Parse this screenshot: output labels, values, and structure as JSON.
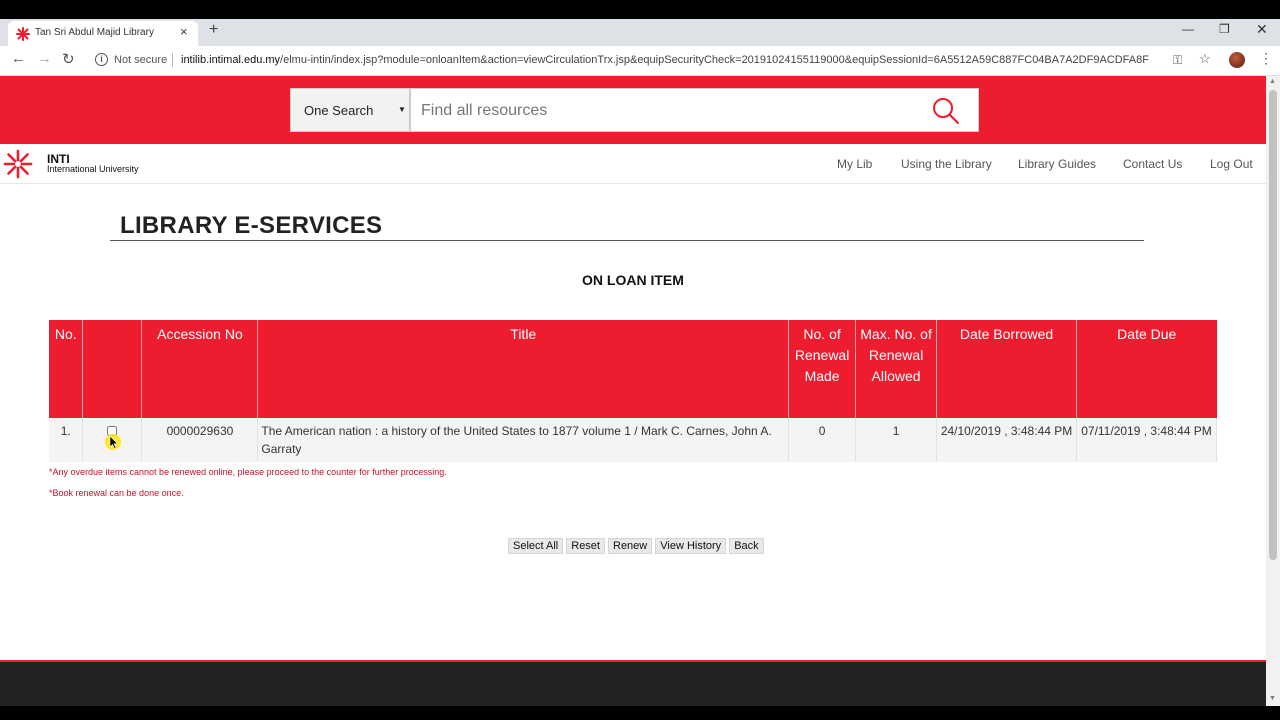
{
  "browser": {
    "tab_title": "Tan Sri Abdul Majid Library",
    "tab_close": "×",
    "new_tab": "+",
    "security_label": "Not secure",
    "url_host": "intilib.intimal.edu.my",
    "url_path": "/elmu-intin/index.jsp?module=onloanItem&action=viewCirculationTrx.jsp&equipSecurityCheck=20191024155119000&equipSessionId=6A5512A59C887FC04BA7A2DF9ACDFA8F"
  },
  "search": {
    "scope_label": "One Search",
    "placeholder": "Find all resources",
    "value": ""
  },
  "header": {
    "logo_name": "INTI",
    "logo_sub": "International University",
    "nav": [
      "My Lib",
      "Using the Library",
      "Library Guides",
      "Contact Us",
      "Log Out"
    ]
  },
  "page": {
    "title": "LIBRARY E-SERVICES",
    "section_title": "ON LOAN ITEM"
  },
  "table": {
    "headers": {
      "no": "No.",
      "select": "",
      "accession": "Accession No",
      "title": "Title",
      "renewal_made": "No. of Renewal Made",
      "renewal_allowed": "Max. No. of Renewal Allowed",
      "borrowed": "Date Borrowed",
      "due": "Date Due"
    },
    "rows": [
      {
        "no": "1.",
        "checked": false,
        "accession": "0000029630",
        "title": "The American nation : a history of the United States to 1877 volume 1 / Mark C. Carnes, John A. Garraty",
        "renewal_made": "0",
        "renewal_allowed": "1",
        "borrowed": "24/10/2019 , 3:48:44 PM",
        "due": "07/11/2019 , 3:48:44 PM"
      }
    ]
  },
  "notes": {
    "overdue": "*Any overdue items cannot be renewed online, please proceed to the counter for further processing.",
    "renewal": "*Book renewal can be done once."
  },
  "actions": {
    "select_all": "Select All",
    "reset": "Reset",
    "renew": "Renew",
    "view_history": "View History",
    "back": "Back"
  },
  "colors": {
    "brand_red": "#ed1c2e",
    "footer_bg": "#232323"
  }
}
